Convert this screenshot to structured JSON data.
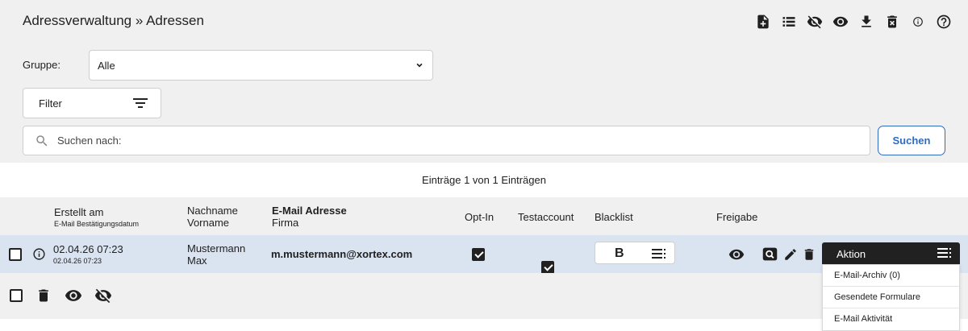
{
  "header": {
    "title": "Adressverwaltung » Adressen",
    "toolbar_icons": [
      "new-document-icon",
      "list-icon",
      "eye-off-icon",
      "eye-icon",
      "download-icon",
      "delete-icon",
      "info-icon",
      "help-icon"
    ]
  },
  "filters": {
    "group_label": "Gruppe:",
    "group_value": "Alle",
    "filter_label": "Filter",
    "search_placeholder": "Suchen nach:",
    "search_button": "Suchen"
  },
  "table": {
    "entries_info": "Einträge 1 von 1 Einträgen",
    "headers": {
      "created": "Erstellt am",
      "created_sub": "E-Mail Bestätigungsdatum",
      "lastname": "Nachname",
      "firstname": "Vorname",
      "email": "E-Mail Adresse",
      "company": "Firma",
      "optin": "Opt-In",
      "testaccount": "Testaccount",
      "blacklist": "Blacklist",
      "freigabe": "Freigabe"
    },
    "rows": [
      {
        "created": "02.04.26 07:23",
        "confirmed": "02.04.26 07:23",
        "lastname": "Mustermann",
        "firstname": "Max",
        "email": "m.mustermann@xortex.com",
        "company": "",
        "optin": true,
        "testaccount": true,
        "blacklist_label": "B"
      }
    ]
  },
  "action_menu": {
    "label": "Aktion",
    "items": [
      "E-Mail-Archiv (0)",
      "Gesendete Formulare",
      "E-Mail Aktivität"
    ]
  },
  "colors": {
    "header_bg": "#f0f0f0",
    "row_selected_bg": "#dae3f0",
    "accent": "#2f6cc0",
    "dark": "#212121"
  }
}
